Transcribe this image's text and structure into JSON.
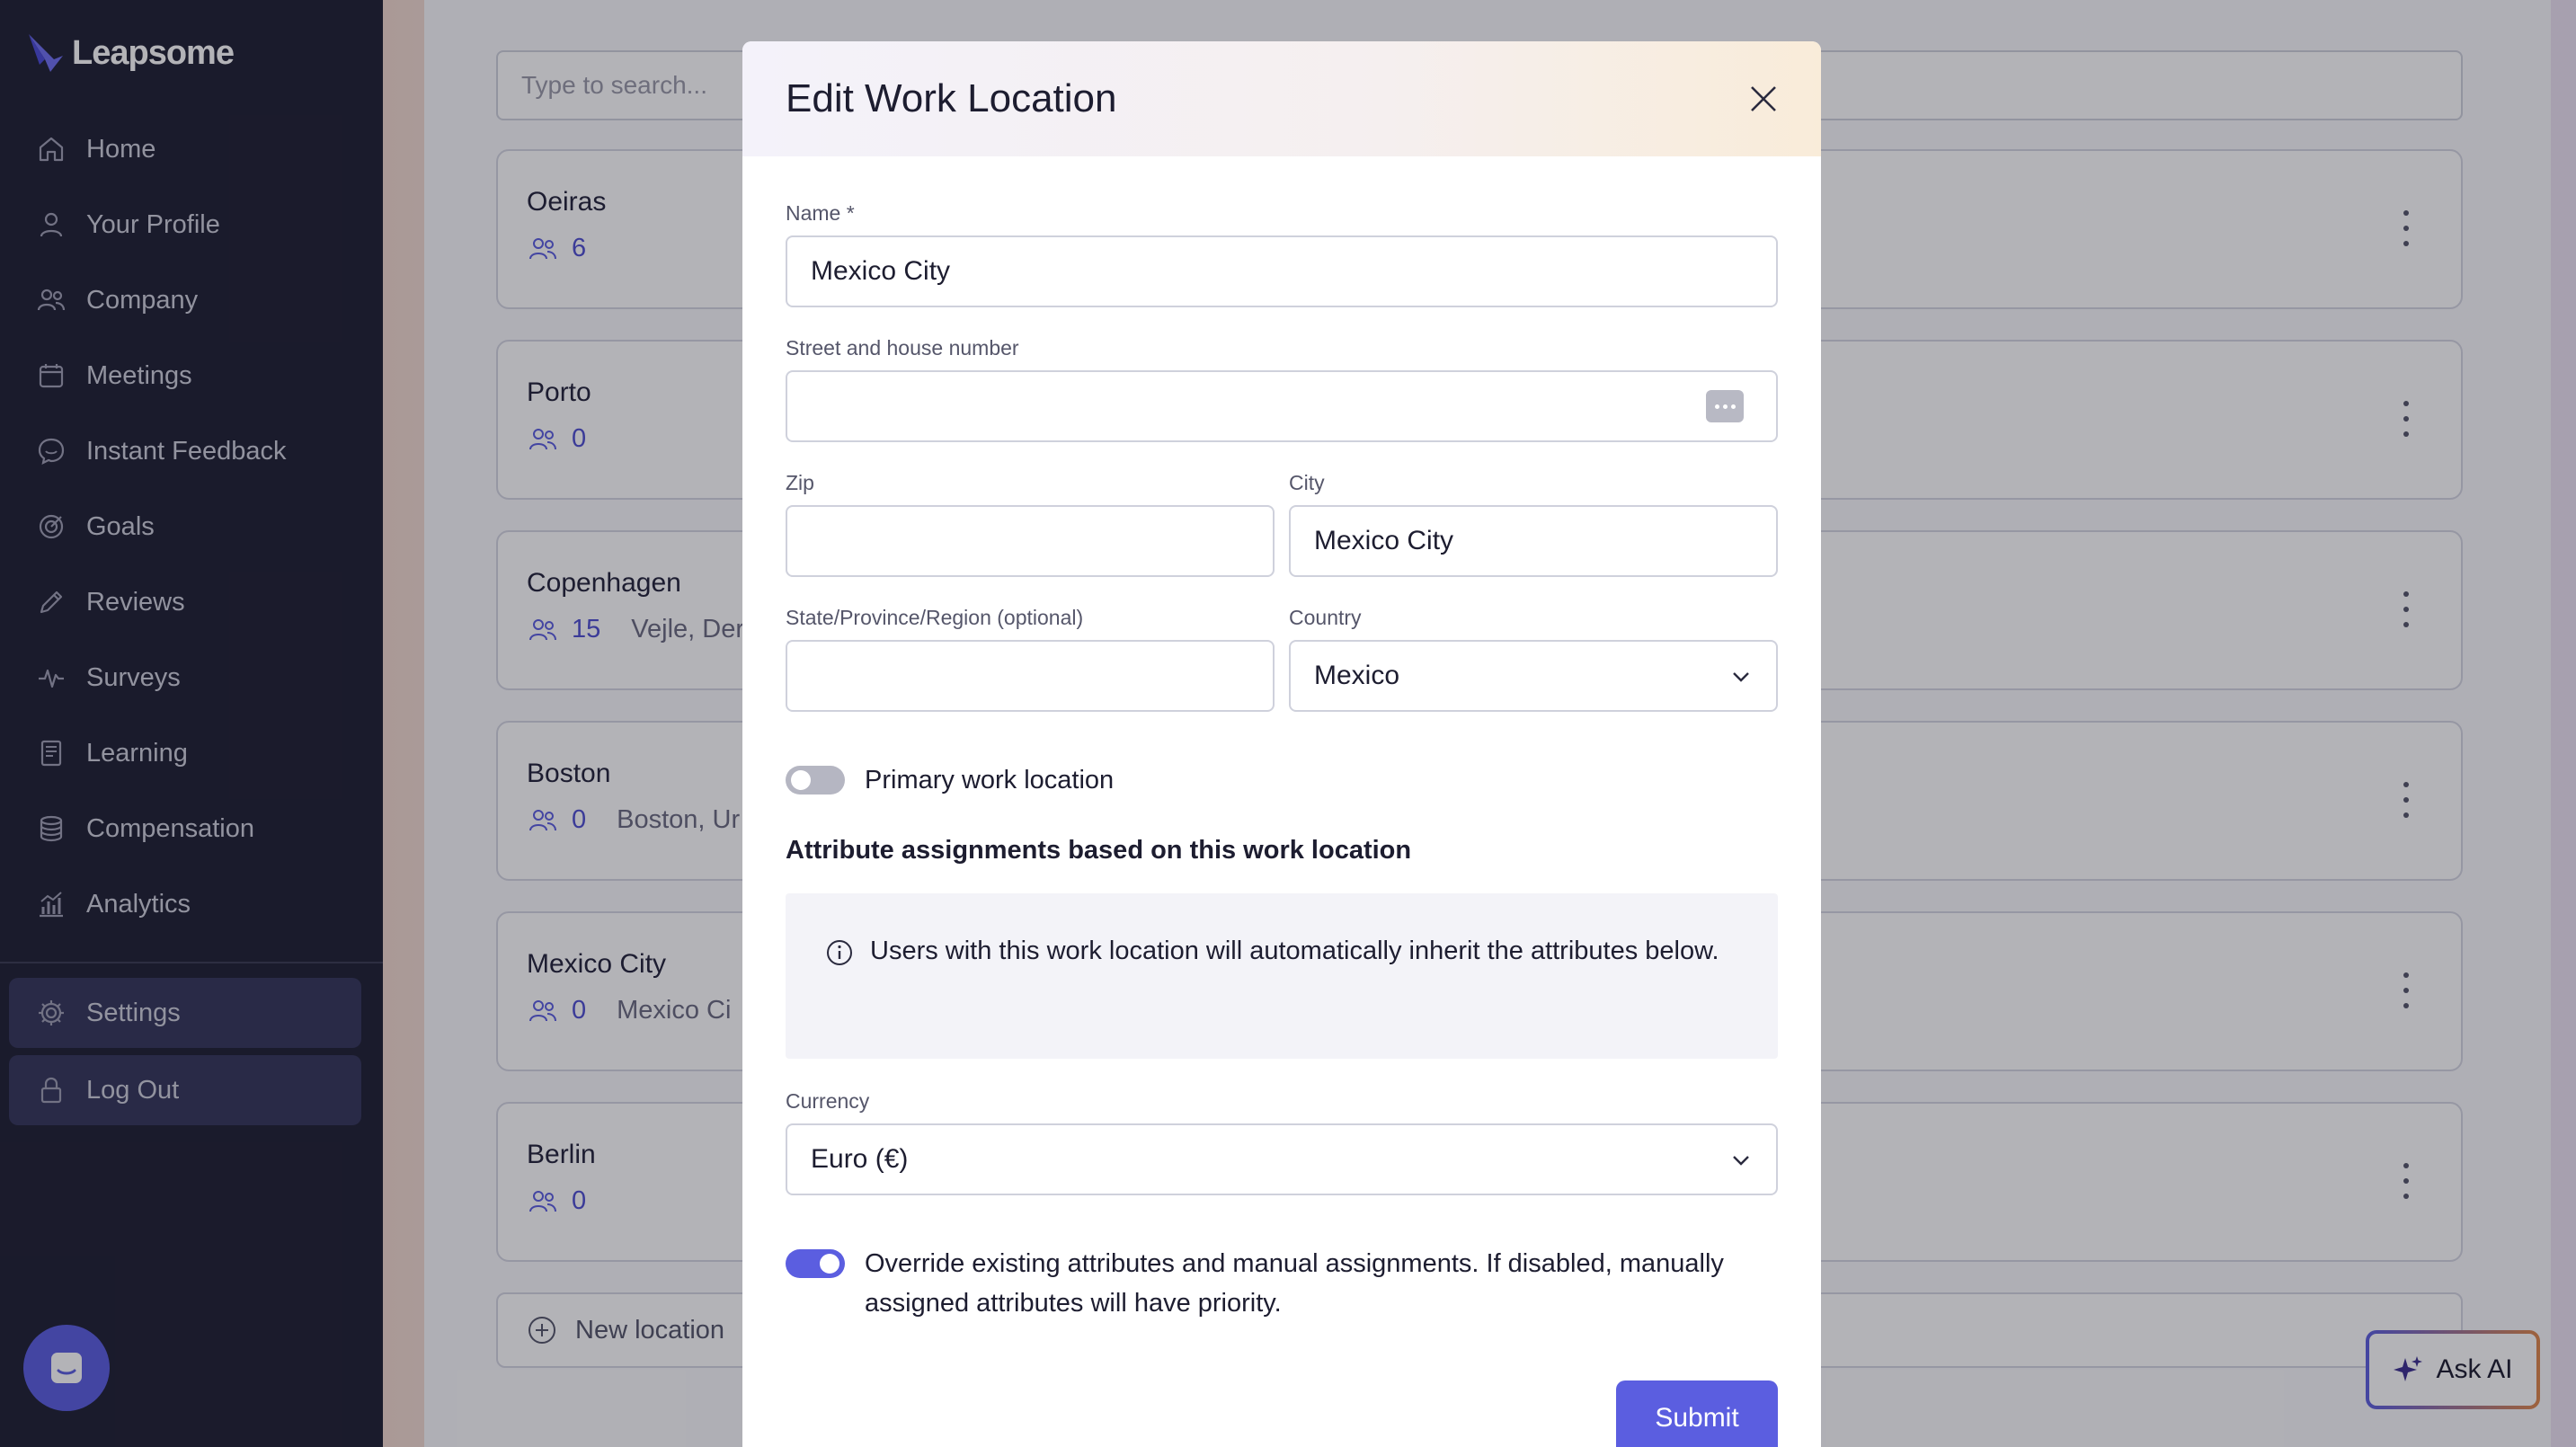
{
  "app": {
    "name": "Leapsome"
  },
  "sidebar": {
    "items": [
      {
        "label": "Home",
        "icon": "home-icon"
      },
      {
        "label": "Your Profile",
        "icon": "user-icon"
      },
      {
        "label": "Company",
        "icon": "people-icon"
      },
      {
        "label": "Meetings",
        "icon": "calendar-icon"
      },
      {
        "label": "Instant Feedback",
        "icon": "chat-icon"
      },
      {
        "label": "Goals",
        "icon": "target-icon"
      },
      {
        "label": "Reviews",
        "icon": "pencil-icon"
      },
      {
        "label": "Surveys",
        "icon": "pulse-icon"
      },
      {
        "label": "Learning",
        "icon": "book-icon"
      },
      {
        "label": "Compensation",
        "icon": "coins-icon"
      },
      {
        "label": "Analytics",
        "icon": "chart-icon"
      }
    ],
    "bottom": [
      {
        "label": "Settings",
        "icon": "gear-icon"
      },
      {
        "label": "Log Out",
        "icon": "lock-icon"
      }
    ]
  },
  "main": {
    "search_placeholder": "Type to search...",
    "locations": [
      {
        "name": "Oeiras",
        "count": "6",
        "address": ""
      },
      {
        "name": "Porto",
        "count": "0",
        "address": ""
      },
      {
        "name": "Copenhagen",
        "count": "15",
        "address": "Vejle, Der"
      },
      {
        "name": "Boston",
        "count": "0",
        "address": "Boston, Ur"
      },
      {
        "name": "Mexico City",
        "count": "0",
        "address": "Mexico Ci"
      },
      {
        "name": "Berlin",
        "count": "0",
        "address": ""
      }
    ],
    "new_location_label": "New location"
  },
  "modal": {
    "title": "Edit Work Location",
    "name_label": "Name *",
    "name_value": "Mexico City",
    "street_label": "Street and house number",
    "street_value": "",
    "zip_label": "Zip",
    "zip_value": "",
    "city_label": "City",
    "city_value": "Mexico City",
    "state_label": "State/Province/Region (optional)",
    "state_value": "",
    "country_label": "Country",
    "country_value": "Mexico",
    "primary_label": "Primary work location",
    "primary_enabled": false,
    "attributes_title": "Attribute assignments based on this work location",
    "info_text": "Users with this work location will automatically inherit the attributes below.",
    "currency_label": "Currency",
    "currency_value": "Euro (€)",
    "override_label": "Override existing attributes and manual assignments. If disabled, manually assigned attributes will have priority.",
    "override_enabled": true,
    "submit_label": "Submit"
  },
  "ask_ai": {
    "label": "Ask AI"
  },
  "colors": {
    "accent": "#5b5ee0",
    "sidebar_bg": "#1e1f33",
    "count_text": "#4f4fd2"
  }
}
